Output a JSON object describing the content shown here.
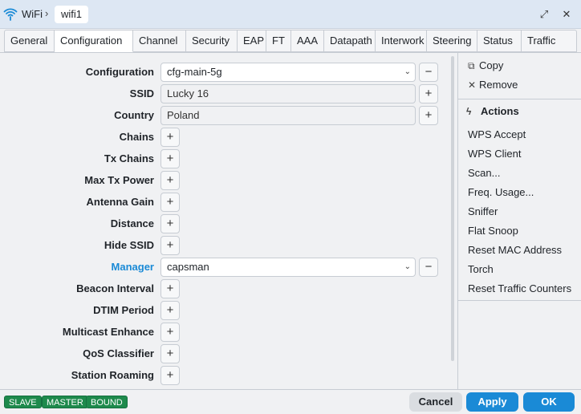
{
  "titlebar": {
    "app": "WiFi",
    "separator": "›",
    "item": "wifi1",
    "restore_glyph": "⤢",
    "close_glyph": "✕"
  },
  "tabs": [
    "General",
    "Configuration",
    "Channel",
    "Security",
    "EAP",
    "FT",
    "AAA",
    "Datapath",
    "Interwork",
    "Steering",
    "Status",
    "Traffic"
  ],
  "active_tab": "Configuration",
  "form": {
    "configuration": {
      "label": "Configuration",
      "value": "cfg-main-5g"
    },
    "ssid": {
      "label": "SSID",
      "value": "Lucky 16"
    },
    "country": {
      "label": "Country",
      "value": "Poland"
    },
    "chains": {
      "label": "Chains"
    },
    "tx_chains": {
      "label": "Tx Chains"
    },
    "max_tx_power": {
      "label": "Max Tx Power"
    },
    "antenna_gain": {
      "label": "Antenna Gain"
    },
    "distance": {
      "label": "Distance"
    },
    "hide_ssid": {
      "label": "Hide SSID"
    },
    "manager": {
      "label": "Manager",
      "value": "capsman"
    },
    "beacon_interval": {
      "label": "Beacon Interval"
    },
    "dtim_period": {
      "label": "DTIM Period"
    },
    "multicast_enhance": {
      "label": "Multicast Enhance"
    },
    "qos_classifier": {
      "label": "QoS Classifier"
    },
    "station_roaming": {
      "label": "Station Roaming"
    },
    "plus": "+",
    "minus": "−",
    "chevron": "⌄"
  },
  "sidebar": {
    "copy": "Copy",
    "remove": "Remove",
    "actions_heading": "Actions",
    "actions": [
      "WPS Accept",
      "WPS Client",
      "Scan...",
      "Freq. Usage...",
      "Sniffer",
      "Flat Snoop",
      "Reset MAC Address",
      "Torch",
      "Reset Traffic Counters"
    ]
  },
  "footer": {
    "badges": [
      "SLAVE",
      "MASTER",
      "BOUND"
    ],
    "cancel": "Cancel",
    "apply": "Apply",
    "ok": "OK"
  },
  "colors": {
    "accent": "#1a8ad6",
    "badge": "#1e8a4c",
    "titlebar": "#dde7f3"
  }
}
